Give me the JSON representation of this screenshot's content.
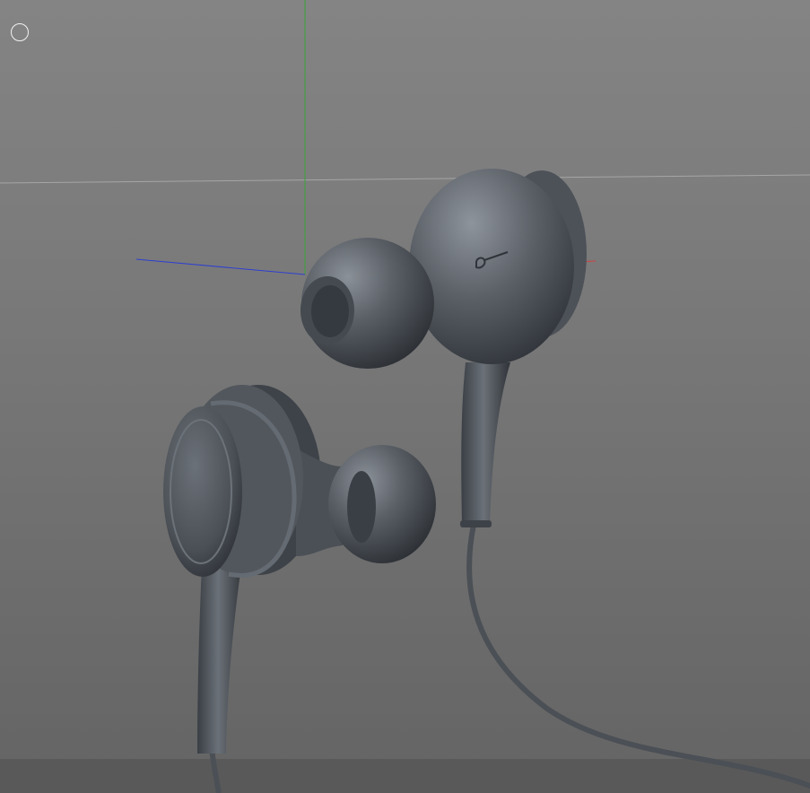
{
  "viewport": {
    "background_top": "#848484",
    "background_bottom": "#646464",
    "axis_colors": {
      "x": "#d04040",
      "y": "#39a439",
      "z": "#2f3fd0"
    },
    "model_color": "#565b62",
    "model_highlight": "#8a9098",
    "model_shadow": "#2f3338",
    "display_mode_icon": "circle-outline-icon"
  }
}
